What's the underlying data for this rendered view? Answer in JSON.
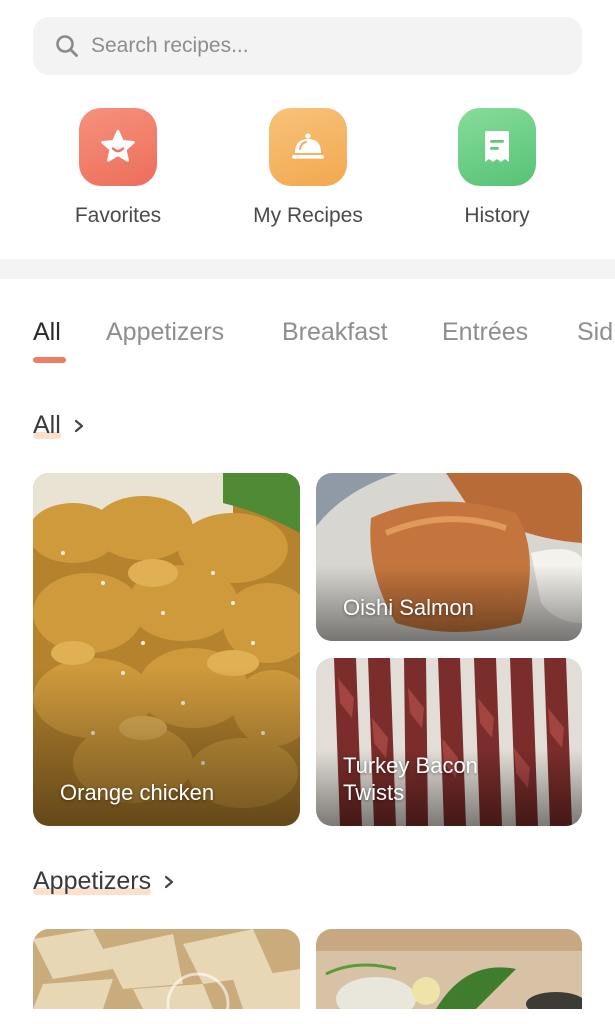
{
  "search": {
    "placeholder": "Search recipes..."
  },
  "shortcuts": [
    {
      "label": "Favorites",
      "icon": "star-icon",
      "color": "#ee7560"
    },
    {
      "label": "My Recipes",
      "icon": "cloche-icon",
      "color": "#f4ad58"
    },
    {
      "label": "History",
      "icon": "receipt-icon",
      "color": "#5fc77b"
    }
  ],
  "tabs": [
    {
      "label": "All",
      "active": true
    },
    {
      "label": "Appetizers",
      "active": false
    },
    {
      "label": "Breakfast",
      "active": false
    },
    {
      "label": "Entrées",
      "active": false
    },
    {
      "label": "Sid",
      "active": false
    }
  ],
  "sections": [
    {
      "title": "All",
      "cards": [
        {
          "title": "Orange chicken"
        },
        {
          "title": "Oishi Salmon"
        },
        {
          "title": "Turkey Bacon Twists"
        }
      ]
    },
    {
      "title": "Appetizers",
      "cards": [
        {
          "title": ""
        },
        {
          "title": ""
        }
      ]
    }
  ],
  "colors": {
    "accent": "#ee7e64",
    "highlight": "#fbe0cc"
  }
}
